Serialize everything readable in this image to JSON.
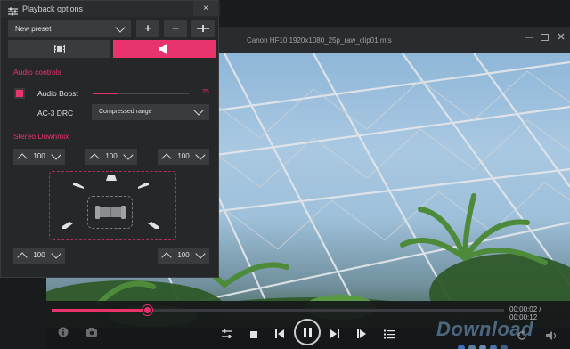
{
  "panel": {
    "title": "Playback options",
    "close_label": "×",
    "preset": {
      "value": "New preset",
      "add_label": "+",
      "remove_label": "−",
      "options_label": "-|-"
    },
    "tabs": [
      {
        "name": "video-icon"
      },
      {
        "name": "speaker-icon",
        "active": true
      }
    ],
    "audio_controls": {
      "heading": "Audio controls",
      "audio_boost": {
        "label": "Audio Boost",
        "checked": true,
        "value": 25,
        "value_text": "25",
        "max": 100
      },
      "drc": {
        "label": "AC-3 DRC",
        "value": "Compressed range"
      }
    },
    "stereo_downmix": {
      "heading": "Stereo Downmix",
      "front_left": "100",
      "center": "100",
      "front_right": "100",
      "rear_left": "100",
      "rear_right": "100"
    }
  },
  "player": {
    "title": "Canon HF10 1920x1080_25p_raw_clip01.mts",
    "time": "00:00:02 / 00:00:12",
    "progress": 0.21,
    "watermark": "Download",
    "watermark_dots": [
      "#3b6fb8",
      "#5b7fa0",
      "#6a8aa6",
      "#4a73a6",
      "#3f5f86"
    ]
  },
  "colors": {
    "accent": "#e8336d",
    "panel_bg": "#262729",
    "control_bg": "#3a3b3f"
  }
}
